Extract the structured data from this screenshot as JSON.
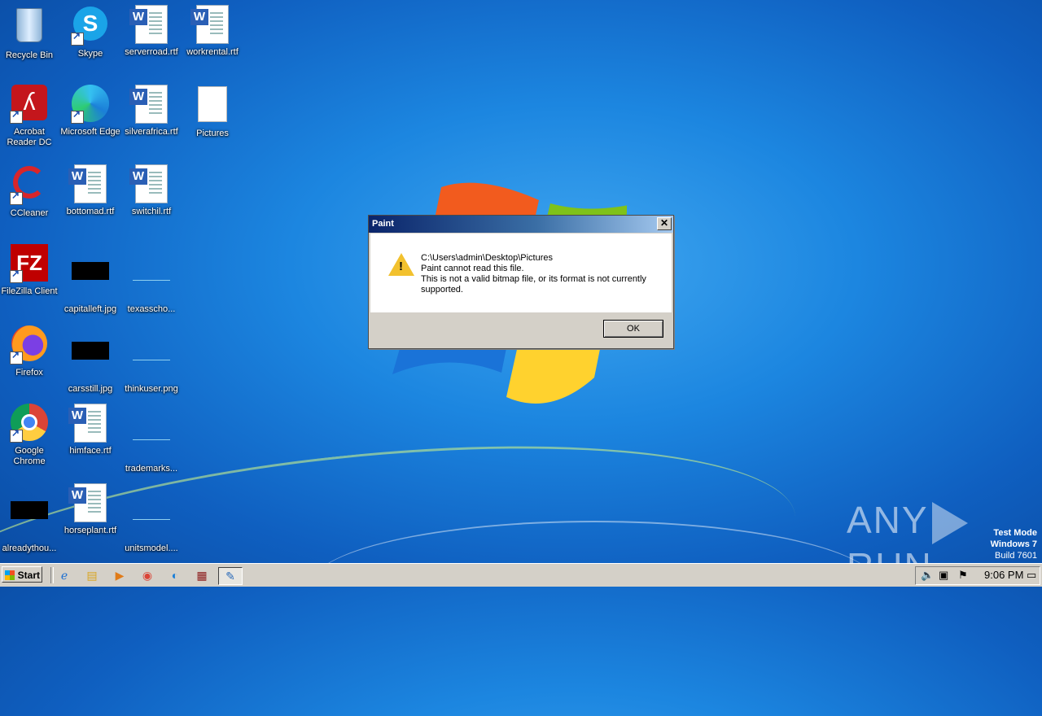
{
  "desktop": {
    "icons": [
      {
        "label": "Recycle Bin",
        "icon": "recycle-bin-icon"
      },
      {
        "label": "Skype",
        "icon": "skype-icon"
      },
      {
        "label": "serverroad.rtf",
        "icon": "word-document-icon"
      },
      {
        "label": "workrental.rtf",
        "icon": "word-document-icon"
      },
      {
        "label": "Acrobat Reader DC",
        "icon": "acrobat-icon"
      },
      {
        "label": "Microsoft Edge",
        "icon": "edge-icon"
      },
      {
        "label": "silverafrica.rtf",
        "icon": "word-document-icon"
      },
      {
        "label": "Pictures",
        "icon": "blank-file-icon"
      },
      {
        "label": "CCleaner",
        "icon": "ccleaner-icon"
      },
      {
        "label": "bottomad.rtf",
        "icon": "word-document-icon"
      },
      {
        "label": "switchil.rtf",
        "icon": "word-document-icon"
      },
      {
        "label": "FileZilla Client",
        "icon": "filezilla-icon"
      },
      {
        "label": "capitalleft.jpg",
        "icon": "image-thumbnail-icon"
      },
      {
        "label": "texasscho...",
        "icon": "image-thumbnail-icon"
      },
      {
        "label": "Firefox",
        "icon": "firefox-icon"
      },
      {
        "label": "carsstill.jpg",
        "icon": "image-thumbnail-icon"
      },
      {
        "label": "thinkuser.png",
        "icon": "image-thumbnail-icon"
      },
      {
        "label": "Google Chrome",
        "icon": "chrome-icon"
      },
      {
        "label": "himface.rtf",
        "icon": "word-document-icon"
      },
      {
        "label": "trademarks...",
        "icon": "image-thumbnail-icon"
      },
      {
        "label": "alreadythou...",
        "icon": "image-thumbnail-icon"
      },
      {
        "label": "horseplant.rtf",
        "icon": "word-document-icon"
      },
      {
        "label": "unitsmodel....",
        "icon": "image-thumbnail-icon"
      }
    ]
  },
  "dialog": {
    "title": "Paint",
    "close": "✕",
    "path": "C:\\Users\\admin\\Desktop\\Pictures",
    "line1": "Paint cannot read this file.",
    "line2": "This is not a valid bitmap file, or its format is not currently supported.",
    "ok": "OK",
    "icon": "warning-icon"
  },
  "watermark": {
    "brand_left": "ANY",
    "brand_right": "RUN",
    "mode": "Test Mode",
    "os": "Windows 7",
    "build": "Build 7601"
  },
  "taskbar": {
    "start": "Start",
    "time": "9:06 PM",
    "apps": [
      "ie-icon",
      "explorer-icon",
      "media-player-icon",
      "chrome-icon",
      "edge-icon",
      "winrar-icon",
      "paint-icon"
    ]
  }
}
